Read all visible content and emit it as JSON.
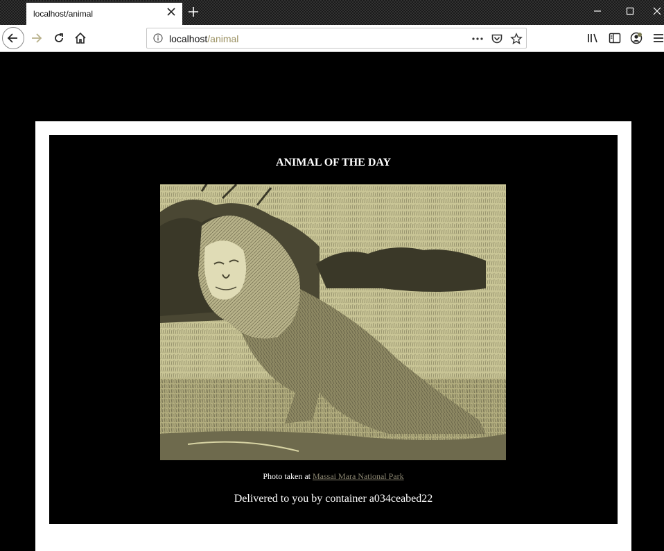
{
  "browser": {
    "tab": {
      "title": "localhost/animal",
      "close_icon": "close-icon"
    },
    "new_tab_icon": "plus-icon",
    "window_controls": [
      "minimize-icon",
      "maximize-icon",
      "close-icon"
    ],
    "nav": {
      "back_icon": "back-arrow-icon",
      "forward_icon": "forward-arrow-icon",
      "reload_icon": "reload-icon",
      "home_icon": "home-icon"
    },
    "urlbar": {
      "host": "localhost",
      "path": "/animal",
      "icons": [
        "info-icon",
        "more-icon",
        "pocket-icon",
        "bookmark-star-icon"
      ]
    },
    "right_icons": [
      "library-icon",
      "sidebar-icon",
      "account-icon",
      "menu-icon"
    ]
  },
  "page": {
    "headline": "ANIMAL OF THE DAY",
    "caption_prefix": "Photo taken at",
    "caption_link": "Massai Mara National Park",
    "delivered": "Delivered to you by container a034ceabed22"
  },
  "colors": {
    "page_background": "#000000",
    "frame": "#ffffff",
    "link": "#8a8570",
    "photo_tint": "#d8d4a4"
  }
}
